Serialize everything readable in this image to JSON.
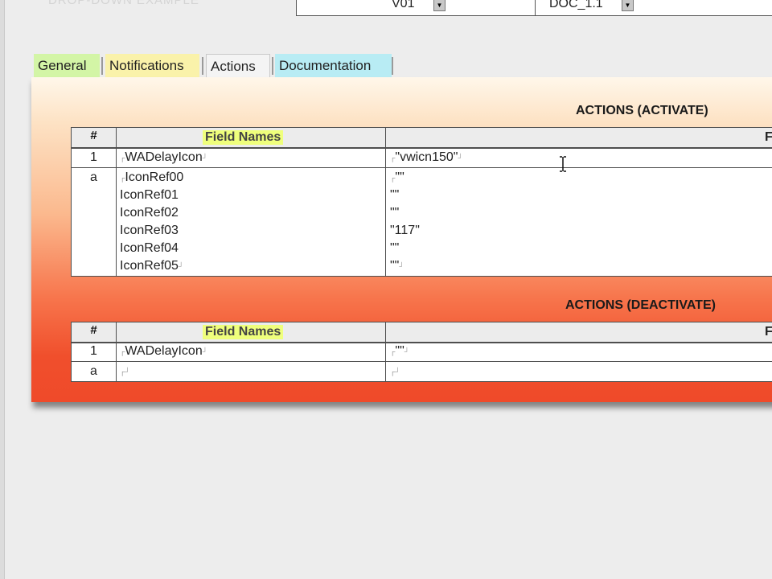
{
  "top": {
    "faded_text": "DROP-DOWN EXAMPLE",
    "field1": "V01",
    "field2": "DOC_1.1"
  },
  "tabs": [
    "General",
    "Notifications",
    "Actions",
    "Documentation"
  ],
  "activate": {
    "title": "ACTIONS (ACTIVATE)",
    "num_header": "#",
    "fields_header": "Field Names",
    "values_header": "F",
    "row1": {
      "num": "1",
      "field": "WADelayIcon",
      "value": "\"vwicn150\""
    },
    "row2": {
      "num": "a",
      "fields": [
        "IconRef00",
        "IconRef01",
        "IconRef02",
        "IconRef03",
        "IconRef04",
        "IconRef05"
      ],
      "values": [
        "\"\"",
        "\"\"",
        "\"\"",
        "\"117\"",
        "\"\"",
        "\"\""
      ]
    }
  },
  "deactivate": {
    "title": "ACTIONS (DEACTIVATE)",
    "num_header": "#",
    "fields_header": "Field Names",
    "values_header": "F",
    "row1": {
      "num": "1",
      "field": "WADelayIcon",
      "value": "\"\""
    },
    "row2": {
      "num": "a",
      "field": "",
      "value": ""
    }
  }
}
